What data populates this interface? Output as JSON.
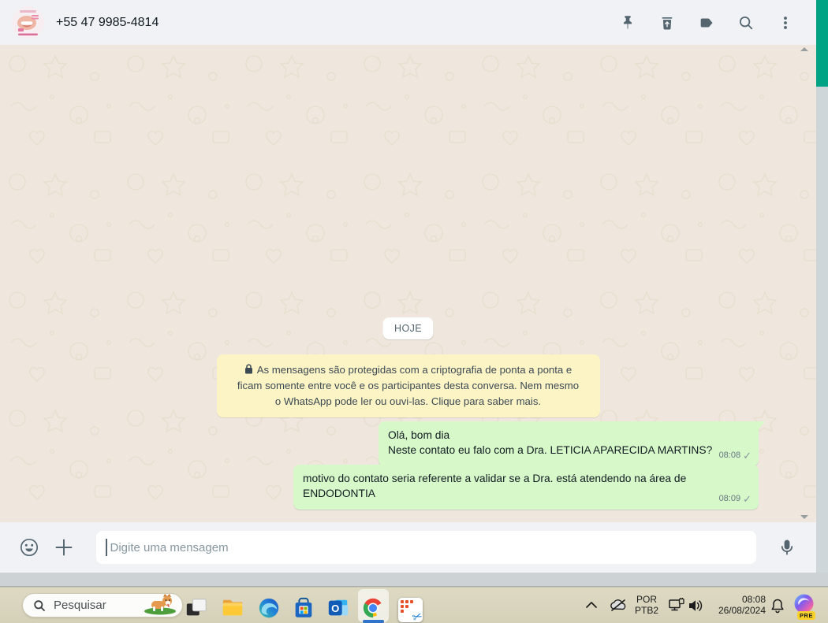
{
  "header": {
    "contact_name": "+55 47 9985-4814"
  },
  "chat": {
    "date_divider": "HOJE",
    "encryption_notice": "As mensagens são protegidas com a criptografia de ponta a ponta e ficam somente entre você e os participantes desta conversa. Nem mesmo o WhatsApp pode ler ou ouvi-las. Clique para saber mais.",
    "messages": [
      {
        "line1": "Olá, bom dia",
        "line2": "Neste contato eu falo com a Dra. LETICIA APARECIDA MARTINS?",
        "time": "08:08"
      },
      {
        "line1": "motivo do contato seria referente a validar se a Dra. está atendendo na área de",
        "line2": "ENDODONTIA",
        "time": "08:09"
      }
    ]
  },
  "composer": {
    "placeholder": "Digite uma mensagem"
  },
  "taskbar": {
    "search": {
      "placeholder": "Pesquisar"
    },
    "tray": {
      "language_top": "POR",
      "language_bottom": "PTB2",
      "time": "08:08",
      "date": "26/08/2024",
      "copilot_badge": "PRE"
    }
  },
  "icons": {
    "message_tick": "✓",
    "scissors": "✂"
  },
  "colors": {
    "outgoing_bubble": "#d7f8c9",
    "encryption_banner": "#fcf4c5",
    "scroll_thumb": "#00a383",
    "header_icon": "#54656f",
    "taskbar_active_indicator": "#2f74c9"
  }
}
